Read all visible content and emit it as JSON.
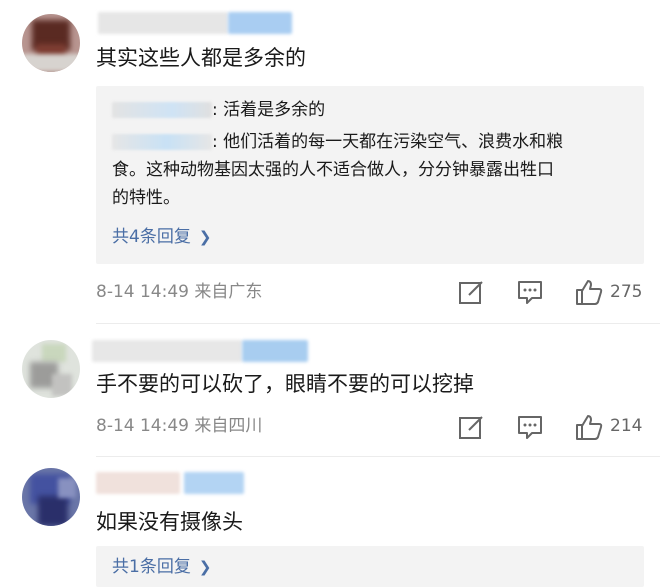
{
  "comments": [
    {
      "text": "其实这些人都是多余的",
      "replies": [
        {
          "text": ": 活着是多余的"
        },
        {
          "text": ": 他们活着的每一天都在污染空气、浪费水和粮",
          "cont1": "食。这种动物基因太强的人不适合做人，分分钟暴露出牲口",
          "cont2": "的特性。"
        }
      ],
      "more_replies": "共4条回复",
      "meta": "8-14 14:49  来自广东",
      "likes": "275"
    },
    {
      "text": "手不要的可以砍了，眼睛不要的可以挖掉",
      "meta": "8-14 14:49  来自四川",
      "likes": "214"
    },
    {
      "text": "如果没有摄像头",
      "more_replies": "共1条回复"
    }
  ],
  "icons": {
    "edit": "edit-icon",
    "comment": "comment-icon",
    "like": "like-icon",
    "chevron": "chevron-right-icon"
  },
  "colors": {
    "link": "#4a6ea5",
    "meta": "#888888",
    "reply_bg": "#f3f3f3"
  }
}
